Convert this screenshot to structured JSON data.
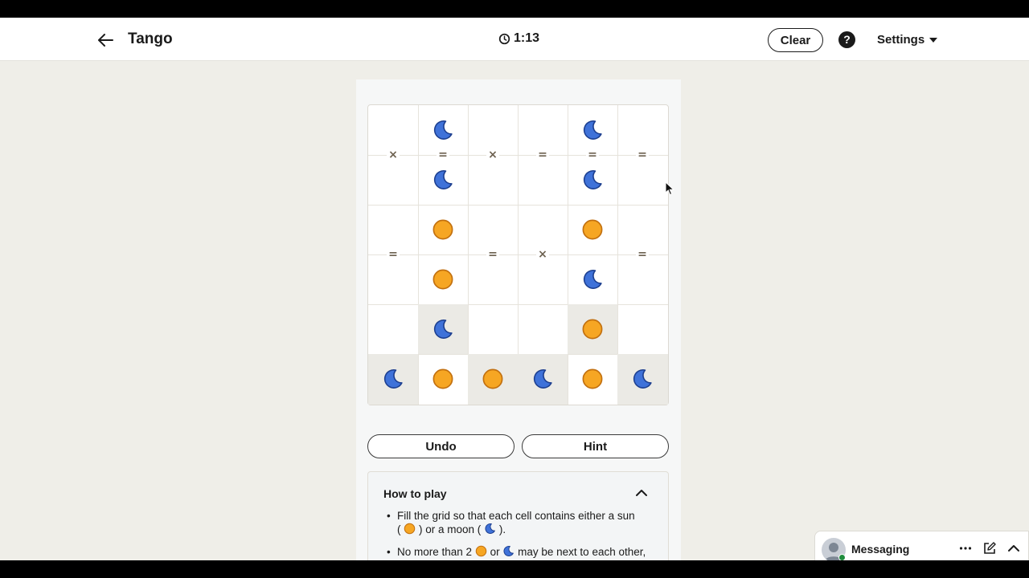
{
  "header": {
    "title": "Tango",
    "timer": "1:13",
    "clear_label": "Clear",
    "help_label": "?",
    "settings_label": "Settings"
  },
  "board": {
    "size": 6,
    "cells": [
      [
        "",
        "moon",
        "",
        "",
        "moon",
        ""
      ],
      [
        "",
        "moon",
        "",
        "",
        "moon",
        ""
      ],
      [
        "",
        "sun",
        "",
        "",
        "sun",
        ""
      ],
      [
        "",
        "sun",
        "",
        "",
        "moon",
        ""
      ],
      [
        "",
        "moon",
        "",
        "",
        "sun",
        ""
      ],
      [
        "moon",
        "sun",
        "sun",
        "moon",
        "sun",
        "moon"
      ]
    ],
    "locked": [
      [
        false,
        false,
        false,
        false,
        false,
        false
      ],
      [
        false,
        false,
        false,
        false,
        false,
        false
      ],
      [
        false,
        false,
        false,
        false,
        false,
        false
      ],
      [
        false,
        false,
        false,
        false,
        false,
        false
      ],
      [
        false,
        true,
        false,
        false,
        true,
        false
      ],
      [
        true,
        false,
        true,
        true,
        false,
        true
      ]
    ],
    "constraints": [
      {
        "between": [
          [
            0,
            0
          ],
          [
            1,
            0
          ]
        ],
        "symbol": "×"
      },
      {
        "between": [
          [
            0,
            1
          ],
          [
            1,
            1
          ]
        ],
        "symbol": "="
      },
      {
        "between": [
          [
            0,
            2
          ],
          [
            1,
            2
          ]
        ],
        "symbol": "×"
      },
      {
        "between": [
          [
            0,
            3
          ],
          [
            1,
            3
          ]
        ],
        "symbol": "="
      },
      {
        "between": [
          [
            0,
            4
          ],
          [
            1,
            4
          ]
        ],
        "symbol": "="
      },
      {
        "between": [
          [
            0,
            5
          ],
          [
            1,
            5
          ]
        ],
        "symbol": "="
      },
      {
        "between": [
          [
            2,
            0
          ],
          [
            3,
            0
          ]
        ],
        "symbol": "="
      },
      {
        "between": [
          [
            2,
            2
          ],
          [
            3,
            2
          ]
        ],
        "symbol": "="
      },
      {
        "between": [
          [
            2,
            3
          ],
          [
            3,
            3
          ]
        ],
        "symbol": "×"
      },
      {
        "between": [
          [
            2,
            5
          ],
          [
            3,
            5
          ]
        ],
        "symbol": "="
      }
    ]
  },
  "actions": {
    "undo_label": "Undo",
    "hint_label": "Hint"
  },
  "how_to_play": {
    "title": "How to play",
    "rule1": {
      "a": "Fill the grid so that each cell contains either a sun",
      "b": "(",
      "c": ") or a moon (",
      "d": ")."
    },
    "rule2": {
      "a": "No more than 2",
      "b": "or",
      "c": "may be next to each other, either vertically or horizontally."
    }
  },
  "messaging": {
    "label": "Messaging"
  },
  "colors": {
    "sun_fill": "#f6a623",
    "sun_stroke": "#c2700f",
    "moon_fill": "#3f72d9",
    "moon_stroke": "#1d3f8f",
    "locked_cell": "#ebeae5",
    "constraint": "#6d6150"
  }
}
